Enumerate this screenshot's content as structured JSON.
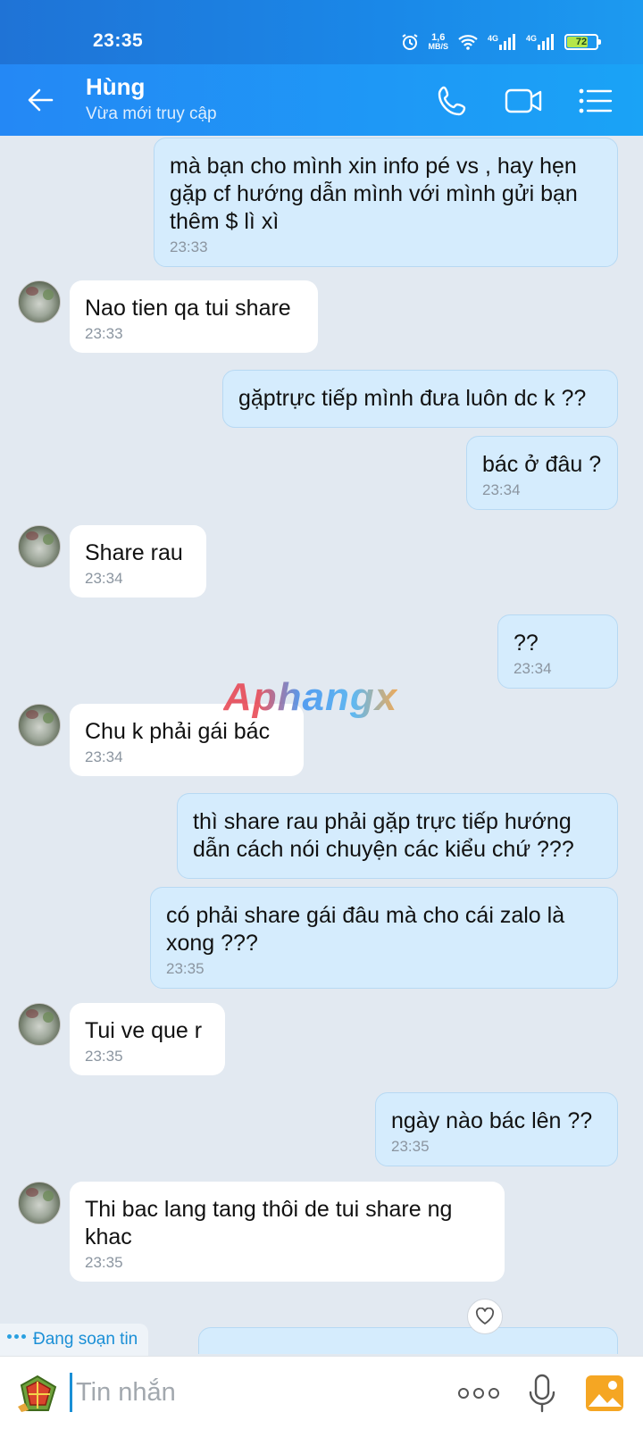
{
  "status_bar": {
    "time": "23:35",
    "net_speed_value": "1,6",
    "net_speed_unit": "MB/S",
    "net_label_1": "4G",
    "net_label_2": "4G",
    "battery_level": "72",
    "battery_fraction": 0.72
  },
  "header": {
    "contact_name": "Hùng",
    "contact_status": "Vừa mới truy cập",
    "icons": [
      "back-arrow-icon",
      "phone-icon",
      "video-call-icon",
      "menu-icon"
    ]
  },
  "messages": [
    {
      "dir": "out",
      "text": "mà bạn cho mình xin info pé vs , hay hẹn gặp cf hướng dẫn mình với mình gửi bạn thêm $ lì xì",
      "time": "23:33"
    },
    {
      "dir": "in",
      "text": "Nao tien qa tui share",
      "time": "23:33"
    },
    {
      "dir": "out",
      "text": "gặptrực tiếp mình đưa luôn dc k ??",
      "time": ""
    },
    {
      "dir": "out",
      "text": "bác ở đâu ?",
      "time": "23:34"
    },
    {
      "dir": "in",
      "text": "Share rau",
      "time": "23:34"
    },
    {
      "dir": "out",
      "text": "??",
      "time": "23:34"
    },
    {
      "dir": "in",
      "text": "Chu k phải gái bác",
      "time": "23:34"
    },
    {
      "dir": "out",
      "text": "thì share rau phải gặp trực tiếp hướng dẫn cách nói chuyện các kiểu chứ ???",
      "time": ""
    },
    {
      "dir": "out",
      "text": "có phải share gái đâu mà cho cái zalo là xong ???",
      "time": "23:35"
    },
    {
      "dir": "in",
      "text": "Tui ve que r",
      "time": "23:35"
    },
    {
      "dir": "out",
      "text": "ngày nào bác lên ??",
      "time": "23:35"
    },
    {
      "dir": "in",
      "text": "Thi bac lang tang thôi de tui share ng khac",
      "time": "23:35"
    }
  ],
  "watermark": "Aphangx",
  "typing_indicator": "Đang soạn tin",
  "input": {
    "placeholder": "Tin nhắn",
    "icons": [
      "sticker-icon",
      "more-icon",
      "mic-icon",
      "image-icon"
    ]
  },
  "colors": {
    "header": "#1f8ef0",
    "outgoing_bubble": "#d5ecfd",
    "incoming_bubble": "#ffffff",
    "chat_background": "#e2e9f1"
  }
}
